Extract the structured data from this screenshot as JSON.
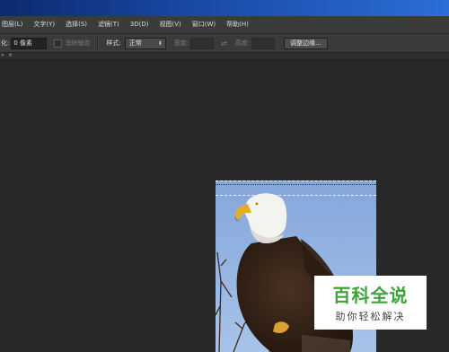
{
  "menu": {
    "items": [
      "图层(L)",
      "文字(Y)",
      "选择(S)",
      "滤镜(T)",
      "3D(D)",
      "视图(V)",
      "窗口(W)",
      "帮助(H)"
    ]
  },
  "options": {
    "feather_label": "化:",
    "feather_value": "0 像素",
    "antialias_label": "消除锯齿",
    "style_label": "样式:",
    "style_value": "正常",
    "width_label": "宽度:",
    "swap_glyph": "⇄",
    "height_label": "高度:",
    "refine_edge_label": "调整边缘..."
  },
  "tabstrip": {
    "left_mark": "»",
    "tab_mark": "×"
  },
  "watermark": {
    "title": "百科全说",
    "subtitle": "助你轻松解决"
  },
  "colors": {
    "titlebar_start": "#0b2a6e",
    "titlebar_end": "#2b6fd6",
    "workspace": "#282828",
    "watermark_green": "#3ea43a"
  }
}
